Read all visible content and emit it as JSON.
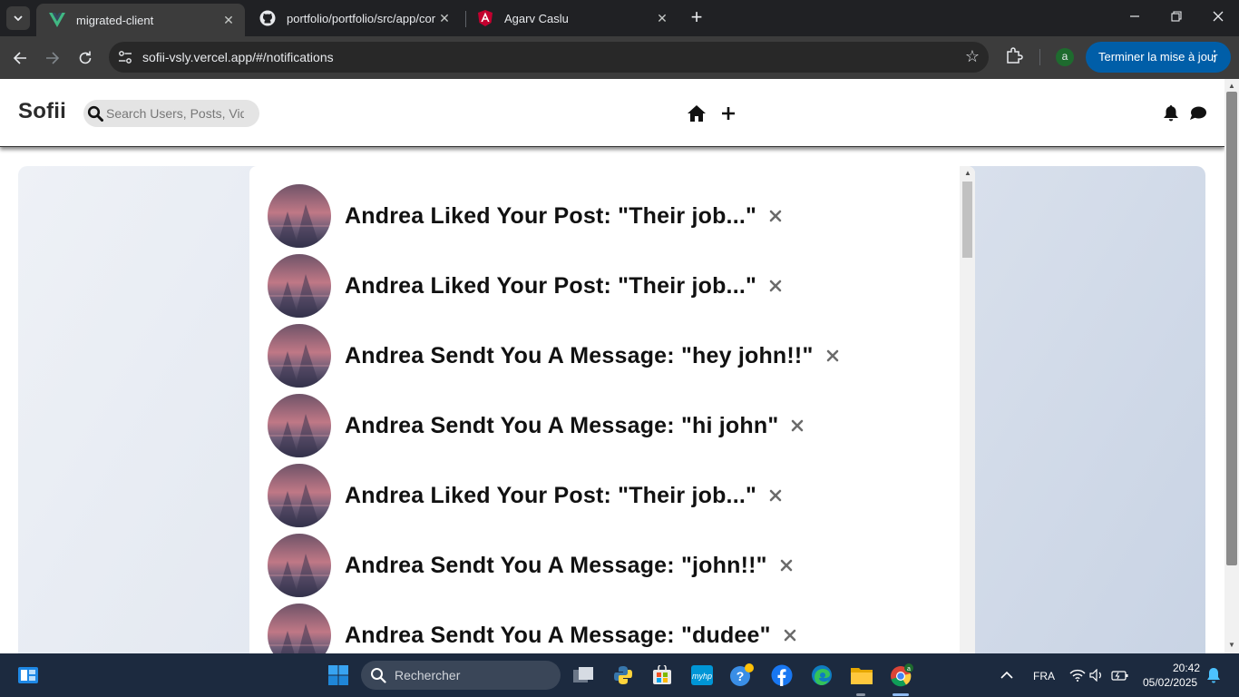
{
  "browser": {
    "tabs": [
      {
        "title": "migrated-client",
        "active": true,
        "favicon": "vue-icon"
      },
      {
        "title": "portfolio/portfolio/src/app/com",
        "active": false,
        "favicon": "github-icon"
      },
      {
        "title": "Agarv Caslu",
        "active": false,
        "favicon": "angular-icon"
      }
    ],
    "url": "sofii-vsly.vercel.app/#/notifications",
    "profile_initial": "a",
    "update_label": "Terminer la mise à jour"
  },
  "app": {
    "logo": "Sofii",
    "search_placeholder": "Search Users, Posts, Videos...",
    "nav_icons": [
      "home-icon",
      "plus-icon",
      "bell-icon",
      "chat-icon"
    ]
  },
  "notifications": [
    {
      "text": "Andrea Liked Your Post: \"Their job...\""
    },
    {
      "text": "Andrea Liked Your Post: \"Their job...\""
    },
    {
      "text": "Andrea Sendt You A Message: \"hey john!!\""
    },
    {
      "text": "Andrea Sendt You A Message: \"hi john\""
    },
    {
      "text": "Andrea Liked Your Post: \"Their job...\""
    },
    {
      "text": "Andrea Sendt You A Message: \"john!!\""
    },
    {
      "text": "Andrea Sendt You A Message: \"dudee\""
    }
  ],
  "taskbar": {
    "search_label": "Rechercher",
    "language": "FRA",
    "time": "20:42",
    "date": "05/02/2025"
  },
  "colors": {
    "accent_update": "#005ea8",
    "taskbar": "#1c2a3f",
    "chrome_dark": "#202124"
  }
}
